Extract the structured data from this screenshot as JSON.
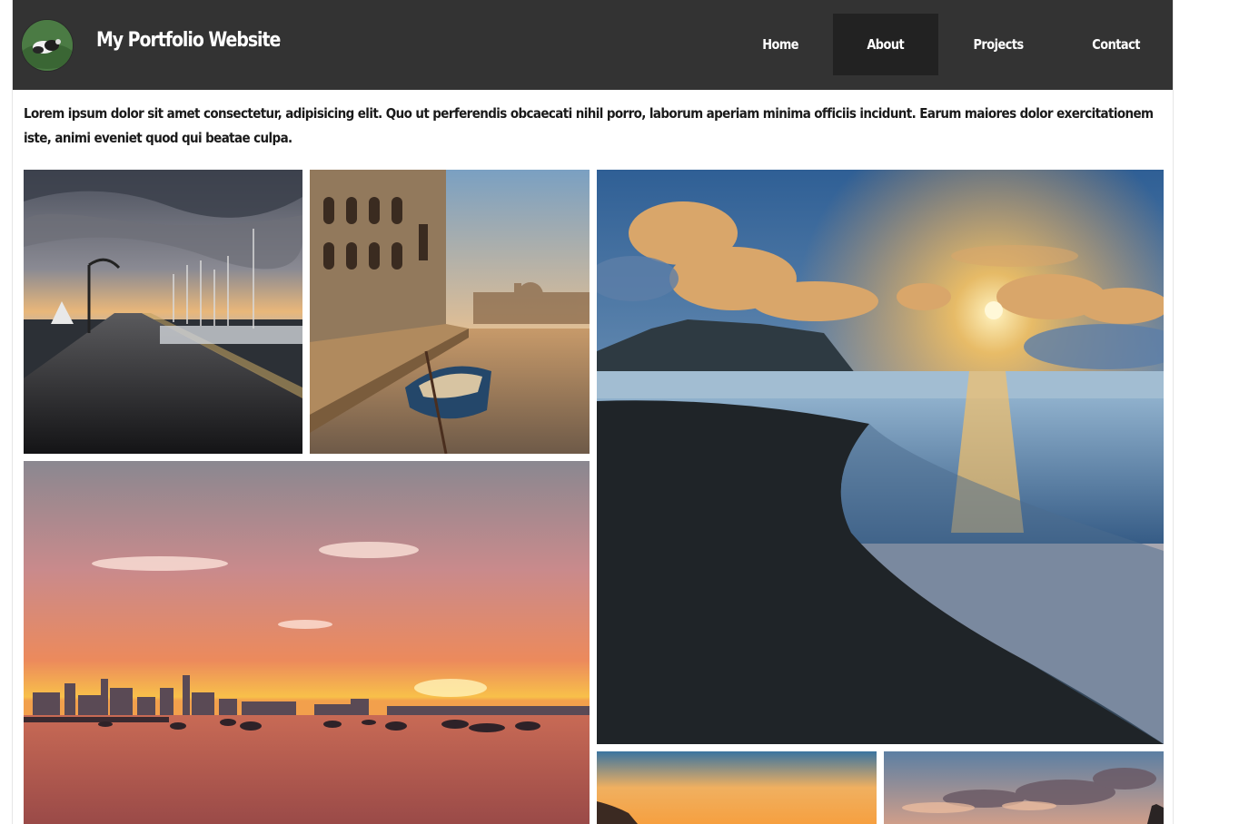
{
  "header": {
    "logo_icon": "profile-photo-icon",
    "site_title": "My Portfolio Website",
    "nav": [
      {
        "label": "Home",
        "active": false
      },
      {
        "label": "About",
        "active": true
      },
      {
        "label": "Projects",
        "active": false
      },
      {
        "label": "Contact",
        "active": false
      }
    ],
    "colors": {
      "navbar_bg": "#333333",
      "active_bg": "#222222",
      "nav_text": "#ffffff"
    }
  },
  "intro": {
    "text": "Lorem ipsum dolor sit amet consectetur, adipisicing elit. Quo ut perferendis obcaecati nihil porro, laborum aperiam minima officiis incidunt. Earum maiores dolor exercitationem iste, animi eveniet quod qui beatae culpa."
  },
  "gallery": {
    "photos": [
      {
        "subject": "pier-marina-sunset"
      },
      {
        "subject": "riverside-palace-boat"
      },
      {
        "subject": "beach-sunset"
      },
      {
        "subject": "city-harbor-sunset"
      },
      {
        "subject": "coast-sunset-small"
      },
      {
        "subject": "clouds-sunset-small"
      }
    ]
  }
}
